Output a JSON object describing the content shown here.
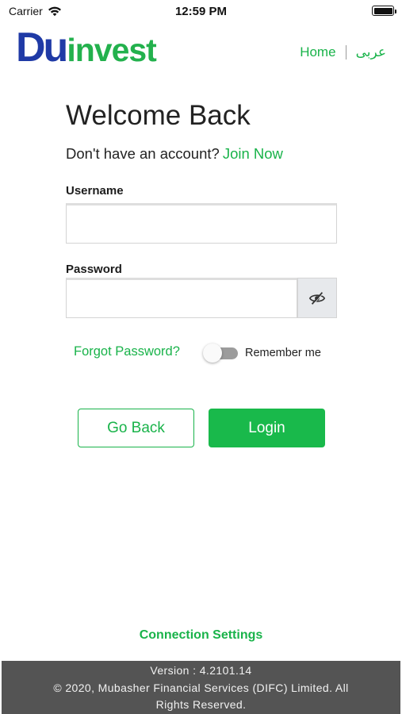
{
  "status_bar": {
    "carrier": "Carrier",
    "time": "12:59 PM",
    "wifi_icon": "wifi-icon",
    "battery_icon": "battery-full-icon"
  },
  "header": {
    "logo_du": "Du",
    "logo_invest": "invest",
    "logo_colors": {
      "du": "#1f3aa6",
      "invest": "#23b14d"
    },
    "nav": {
      "home": "Home",
      "arabic": "عربى"
    }
  },
  "login": {
    "title": "Welcome Back",
    "signup_prompt": "Don't have an account?",
    "signup_link": "Join Now",
    "username_label": "Username",
    "username_value": "",
    "password_label": "Password",
    "password_value": "",
    "password_toggle_icon": "eye-slash-icon",
    "forgot_password": "Forgot Password?",
    "remember_me": "Remember me",
    "remember_me_on": false,
    "back_button": "Go Back",
    "login_button": "Login"
  },
  "connection_settings": "Connection Settings",
  "footer": {
    "version": "Version : 4.2101.14",
    "copyright_line1": "© 2020, Mubasher Financial Services (DIFC) Limited. All",
    "copyright_line2": "Rights Reserved."
  },
  "colors": {
    "accent_green": "#19b34a",
    "brand_blue": "#1f3aa6",
    "footer_bg": "#545454"
  }
}
